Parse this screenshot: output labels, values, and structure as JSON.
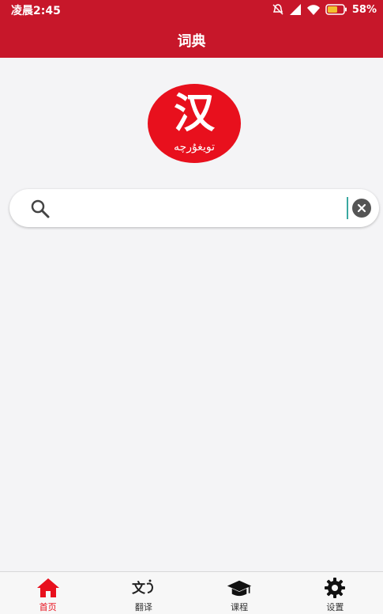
{
  "status_bar": {
    "time": "凌晨2:45",
    "battery": "58%"
  },
  "header": {
    "title": "词典"
  },
  "logo": {
    "glyph": "汉",
    "subtext": "تويغۇرچە"
  },
  "search": {
    "value": "",
    "placeholder": ""
  },
  "bottom_nav": {
    "items": [
      {
        "label": "首页",
        "icon": "home-icon",
        "active": true
      },
      {
        "label": "翻译",
        "icon": "translate-icon",
        "active": false
      },
      {
        "label": "课程",
        "icon": "graduation-cap-icon",
        "active": false
      },
      {
        "label": "设置",
        "icon": "gear-icon",
        "active": false
      }
    ]
  },
  "colors": {
    "brand_red": "#c7172a",
    "logo_red": "#e8101d",
    "active_tab": "#e8101d",
    "background": "#f4f4f6"
  }
}
